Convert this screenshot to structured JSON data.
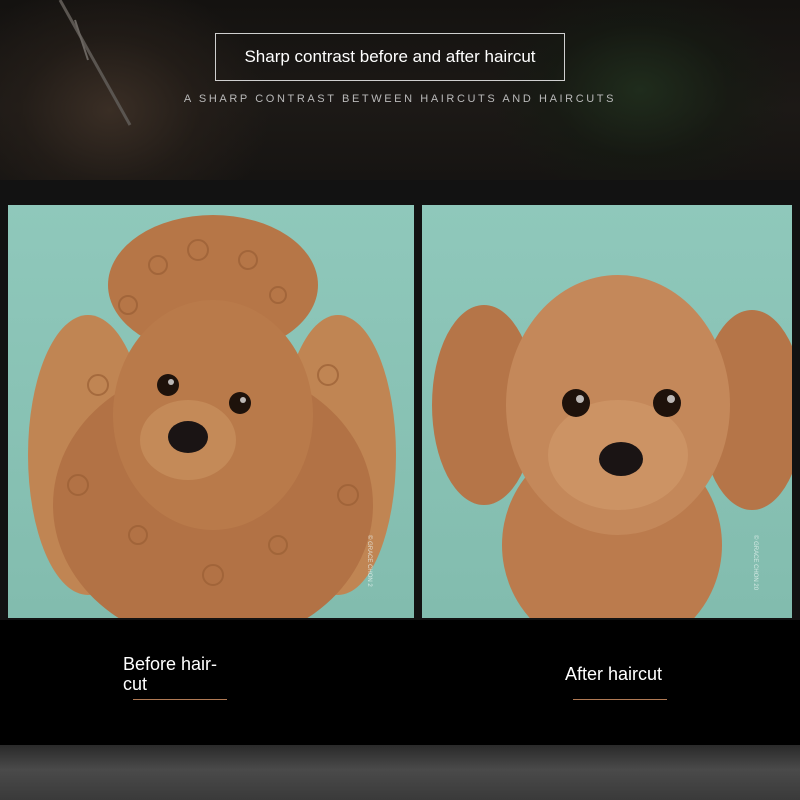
{
  "header": {
    "title": "Sharp contrast before and after haircut",
    "subtitle": "A SHARP CONTRAST BETWEEN HAIRCUTS AND HAIRCUTS"
  },
  "photos": {
    "before": {
      "watermark": "© GRACE CHON 2"
    },
    "after": {
      "watermark": "© GRACE CHON 20"
    }
  },
  "labels": {
    "before": "Before hair-\ncut",
    "after": "After haircut"
  },
  "colors": {
    "backdrop_teal": "#8fc8bb",
    "fur": "#b9784a",
    "underline": "#b07a55"
  }
}
